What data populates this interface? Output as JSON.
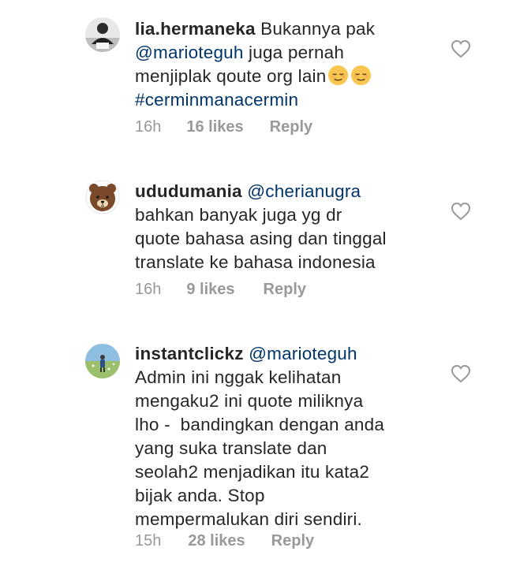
{
  "comments": [
    {
      "username": "lia.hermaneka",
      "text_a": " Bukannya pak",
      "mention": "@marioteguh",
      "text_b": " juga pernah\nmenjiplak qoute org lain",
      "emoji_icon": "relieved-face-emoji-icon",
      "hashtag": "#cerminmanacermin",
      "time": "16h",
      "likes": "16 likes",
      "reply": "Reply"
    },
    {
      "username": "ududumania",
      "mention": "@cherianugra",
      "text": "bahkan banyak juga yg dr\nquote bahasa asing dan tinggal\ntranslate ke bahasa indonesia",
      "avatar_icon": "bear-avatar-icon",
      "time": "16h",
      "likes": "9 likes",
      "reply": "Reply"
    },
    {
      "username": "instantclickz",
      "mention": "@marioteguh",
      "text": "Admin ini nggak kelihatan\nmengaku2 ini quote miliknya\nlho -  bandingkan dengan anda\nyang suka translate dan\nseolah2 menjadikan itu kata2\nbijak anda. Stop\nmempermalukan diri sendiri.",
      "avatar_icon": "landscape-photo-avatar-icon",
      "time": "15h",
      "likes": "28 likes",
      "reply": "Reply"
    }
  ],
  "colors": {
    "text": "#262626",
    "mention": "#003569",
    "meta": "#999999"
  },
  "heart_icon": "heart-outline-icon"
}
